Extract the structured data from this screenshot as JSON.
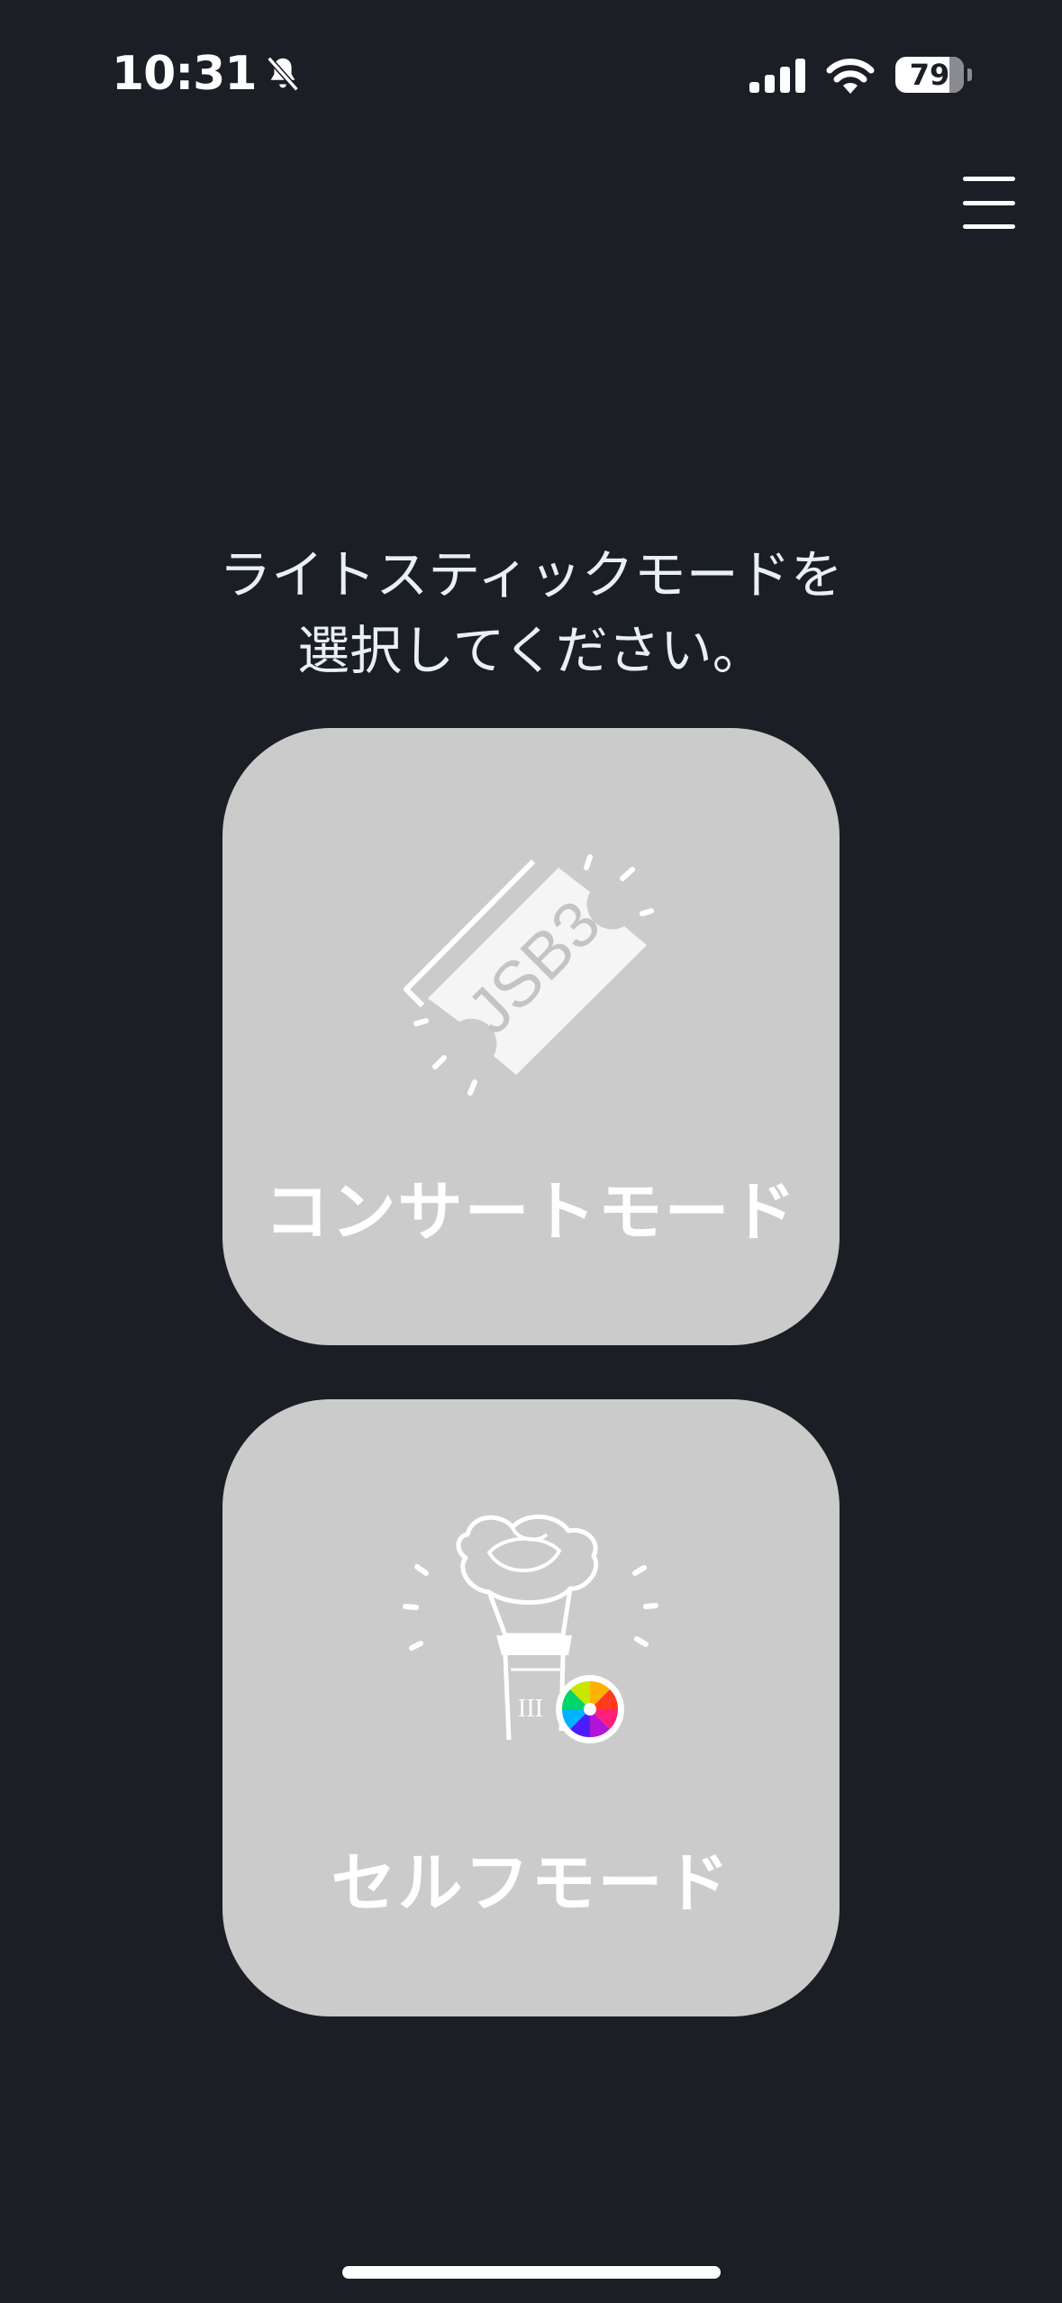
{
  "status_bar": {
    "time": "10:31",
    "battery_level": "79",
    "battery_percent": 79
  },
  "icons": {
    "silent": "bell-slash-icon",
    "signal": "cellular-signal-icon",
    "wifi": "wifi-icon",
    "battery": "battery-icon",
    "menu": "hamburger-menu-icon",
    "ticket": "ticket-icon",
    "light_stick": "light-stick-icon",
    "color_wheel": "color-wheel-icon"
  },
  "prompt": {
    "line1": "ライトスティックモードを",
    "line2": "選択してください。"
  },
  "modes": {
    "concert": {
      "label": "コンサートモード",
      "ticket_text": "JSB3"
    },
    "self": {
      "label": "セルフモード",
      "stick_text": "III"
    }
  },
  "colors": {
    "background": "#1c1e26",
    "card": "#cbcbcb",
    "text": "#ffffff"
  }
}
